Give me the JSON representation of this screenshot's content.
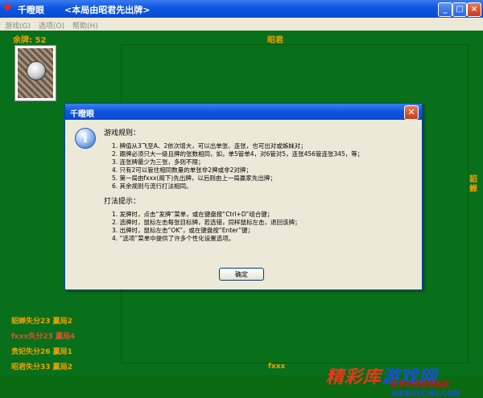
{
  "window": {
    "title": "千瞪眼",
    "subtitle": "<本局由昭君先出牌>",
    "icon": "heart-icon",
    "controls": [
      "_",
      "□",
      "×"
    ]
  },
  "menu": [
    "游戏(G)",
    "选项(O)",
    "帮助(H)"
  ],
  "table": {
    "remaining": "余牌: 52",
    "player_top": "昭君",
    "player_right": "貂蝉",
    "player_bottom": "fxxx"
  },
  "scores": [
    {
      "text": "貂蝉失分23  赢局2",
      "self": false
    },
    {
      "text": "fxxx失分23  赢局4",
      "self": true
    },
    {
      "text": "贵妃失分26  赢局1",
      "self": false
    },
    {
      "text": "昭君失分33  赢局2",
      "self": false
    }
  ],
  "dialog": {
    "title": "千瞪眼",
    "icon": "info-icon",
    "rules_heading": "游戏规则：",
    "rules": [
      "1. 牌值从3飞至A、2依次增大，可以出单张、连张，也可出对或姊妹对；",
      "2. 跟牌必须只大一级且牌的张数相同，如，单5管单4，对6管对5，连张456管连张345，等；",
      "3. 连张牌最少为三张，多则不限；",
      "4. 只有2可以管住相同数量的单张非2牌或非2对牌；",
      "5. 第一局由fxxx(阁下)先出牌，以后则由上一局赢家先出牌；",
      "6. 其余规则与流行打法相同。"
    ],
    "tips_heading": "打法提示：",
    "tips": [
      "1. 发牌时，点击“发牌”菜单，或在键盘按“Ctrl+D”组合键；",
      "2. 选牌时，鼠标左击每张目标牌，若选错，同样鼠标左击，退回该牌；",
      "3. 出牌时，鼠标左击“OK”，或在键盘按“Enter”键；",
      "4. “选项”菜单中提供了许多个性化设置选项。"
    ],
    "ok_label": "确定"
  },
  "watermark": {
    "logo_red": "精彩库",
    "logo_blue": "游戏网",
    "sub": "织梦内容管理系统",
    "url": "WDEDECMS.COM"
  },
  "colors": {
    "table_green": "#08701a",
    "gold_text": "#f0a000",
    "title_blue": "#0c55e0"
  }
}
